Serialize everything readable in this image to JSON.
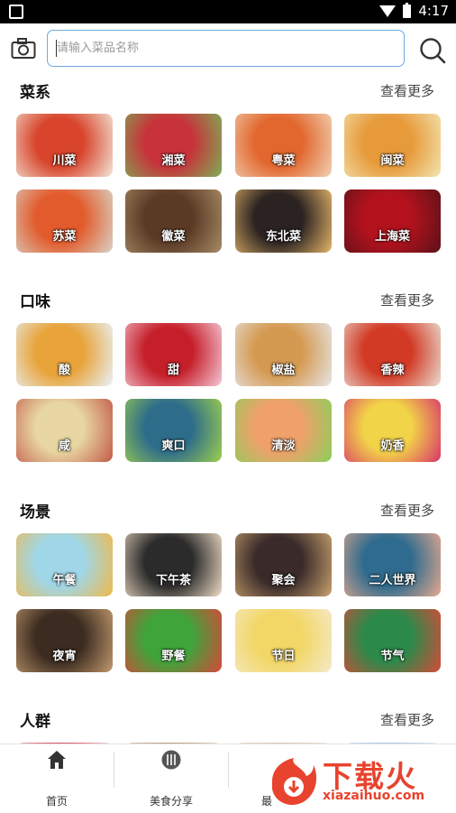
{
  "status": {
    "time": "4:17"
  },
  "search": {
    "placeholder": "请输入菜品名称"
  },
  "sections": [
    {
      "title": "菜系",
      "more": "查看更多",
      "items": [
        {
          "label": "川菜",
          "c1": "#d8452c",
          "c2": "#f3e6d8"
        },
        {
          "label": "湘菜",
          "c1": "#c8323a",
          "c2": "#7fae57"
        },
        {
          "label": "粤菜",
          "c1": "#e2672e",
          "c2": "#f1d2b5"
        },
        {
          "label": "闽菜",
          "c1": "#e79a3a",
          "c2": "#f2e4b0"
        },
        {
          "label": "苏菜",
          "c1": "#e25b2c",
          "c2": "#d9d4c6"
        },
        {
          "label": "徽菜",
          "c1": "#5b3a25",
          "c2": "#a88b66"
        },
        {
          "label": "东北菜",
          "c1": "#2b2321",
          "c2": "#e7b66a"
        },
        {
          "label": "上海菜",
          "c1": "#b3121d",
          "c2": "#5a1118"
        }
      ]
    },
    {
      "title": "口味",
      "more": "查看更多",
      "items": [
        {
          "label": "酸",
          "c1": "#e8a33a",
          "c2": "#e9f3fa"
        },
        {
          "label": "甜",
          "c1": "#c51f2a",
          "c2": "#f5c8d6"
        },
        {
          "label": "椒盐",
          "c1": "#d59a52",
          "c2": "#e6e6e6"
        },
        {
          "label": "香辣",
          "c1": "#d23a25",
          "c2": "#eaded2"
        },
        {
          "label": "咸",
          "c1": "#e8d7a2",
          "c2": "#c25a49"
        },
        {
          "label": "爽口",
          "c1": "#2e6d8a",
          "c2": "#9fd04e"
        },
        {
          "label": "清淡",
          "c1": "#f0a06a",
          "c2": "#8ccf5a"
        },
        {
          "label": "奶香",
          "c1": "#f2d448",
          "c2": "#d8356a"
        }
      ]
    },
    {
      "title": "场景",
      "more": "查看更多",
      "items": [
        {
          "label": "午餐",
          "c1": "#9fd7e8",
          "c2": "#f1b84a"
        },
        {
          "label": "下午茶",
          "c1": "#2b2b2b",
          "c2": "#f0ddc6"
        },
        {
          "label": "聚会",
          "c1": "#3a2b2a",
          "c2": "#c9a26e"
        },
        {
          "label": "二人世界",
          "c1": "#2f6b8e",
          "c2": "#e7a98e"
        },
        {
          "label": "夜宵",
          "c1": "#3b2b20",
          "c2": "#c39a6e"
        },
        {
          "label": "野餐",
          "c1": "#3fa43a",
          "c2": "#d9463a"
        },
        {
          "label": "节日",
          "c1": "#f2d766",
          "c2": "#f5e9c9"
        },
        {
          "label": "节气",
          "c1": "#2b8a4a",
          "c2": "#d64a3a"
        }
      ]
    },
    {
      "title": "人群",
      "more": "查看更多",
      "items": [
        {
          "label": "",
          "c1": "#d7475a",
          "c2": "#f2f2f2"
        },
        {
          "label": "",
          "c1": "#b99b7d",
          "c2": "#ece3d8"
        },
        {
          "label": "",
          "c1": "#d9c5b2",
          "c2": "#f0ece6"
        },
        {
          "label": "",
          "c1": "#a8c3e6",
          "c2": "#eef3f9"
        }
      ]
    }
  ],
  "tabs": [
    {
      "label": "首页",
      "icon": "home-icon"
    },
    {
      "label": "美食分享",
      "icon": "cutlery-icon"
    },
    {
      "label": "最",
      "icon": "heart-icon"
    }
  ],
  "watermark": {
    "text": "下载火",
    "url": "xiazaihuo.com"
  }
}
